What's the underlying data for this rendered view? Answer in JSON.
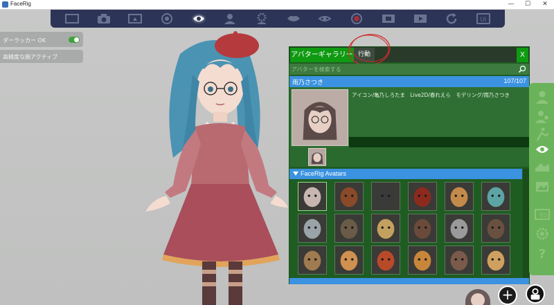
{
  "window": {
    "title": "FaceRig",
    "minimize": "—",
    "maximize": "☐",
    "close": "✕"
  },
  "toolbar": {
    "buttons": [
      {
        "name": "fullscreen-frame-icon"
      },
      {
        "name": "camera-icon"
      },
      {
        "name": "screenshot-upload-icon"
      },
      {
        "name": "webcam-icon"
      },
      {
        "name": "face-tracking-icon",
        "active": true
      },
      {
        "name": "avatar-person-icon"
      },
      {
        "name": "avatar-settings-icon"
      },
      {
        "name": "lips-icon"
      },
      {
        "name": "eye-icon"
      },
      {
        "name": "record-icon"
      },
      {
        "name": "film-strip-icon"
      },
      {
        "name": "playback-icon"
      },
      {
        "name": "refresh-icon"
      },
      {
        "name": "ui-toggle-icon",
        "label": "Ui"
      }
    ]
  },
  "toggles": [
    {
      "label": "ダーラッカー OK",
      "on": true
    },
    {
      "label": "高精度な顔アクティブ"
    }
  ],
  "gallery": {
    "tab_gallery": "アバターギャラリー",
    "tab_action": "行動",
    "close": "X",
    "search_placeholder": "アバターを検索する",
    "selected_name": "雨乃さつき",
    "selected_count": "107/107",
    "credits": "アイコン/亀乃しろたま　Live2D/春れえら　モデリング/雨乃さつき",
    "section_title": "FaceRig Avatars",
    "avatars": [
      {
        "name": "avatar-girl-glasses",
        "color": "#c7b6b0"
      },
      {
        "name": "avatar-red-panda",
        "color": "#8a4a2a"
      },
      {
        "name": "avatar-black-cat",
        "color": "#3a3a3a"
      },
      {
        "name": "avatar-red-demon",
        "color": "#8c2a1e"
      },
      {
        "name": "avatar-cat",
        "color": "#c48a4a"
      },
      {
        "name": "avatar-elf-girl",
        "color": "#5da4a4"
      },
      {
        "name": "avatar-old-woman",
        "color": "#9aa4a8"
      },
      {
        "name": "avatar-old-man",
        "color": "#6a5a48"
      },
      {
        "name": "avatar-blonde-woman",
        "color": "#c4a060"
      },
      {
        "name": "avatar-dragon",
        "color": "#6a4a3a"
      },
      {
        "name": "avatar-zebra-man",
        "color": "#9a9a9a"
      },
      {
        "name": "avatar-wolf-man",
        "color": "#6a5040"
      },
      {
        "name": "avatar-wolf",
        "color": "#a07a50"
      },
      {
        "name": "avatar-shiba-dog",
        "color": "#d09050"
      },
      {
        "name": "avatar-fox",
        "color": "#b84a2a"
      },
      {
        "name": "avatar-burger",
        "color": "#c8863a"
      },
      {
        "name": "avatar-bald-man",
        "color": "#7a5a4a"
      },
      {
        "name": "avatar-blonde-man",
        "color": "#d0a060"
      }
    ]
  },
  "side_panel": {
    "buttons": [
      {
        "name": "avatar-silhouette-icon"
      },
      {
        "name": "customize-avatar-icon"
      },
      {
        "name": "stance-icon"
      },
      {
        "name": "face-profile-icon"
      },
      {
        "name": "expressions-icon"
      },
      {
        "name": "background-icon"
      },
      {
        "name": "ed-icon",
        "label": "ED"
      },
      {
        "name": "settings-gear-icon"
      },
      {
        "name": "help-icon",
        "label": "?"
      }
    ]
  },
  "bottom_controls": {
    "add": "+"
  }
}
